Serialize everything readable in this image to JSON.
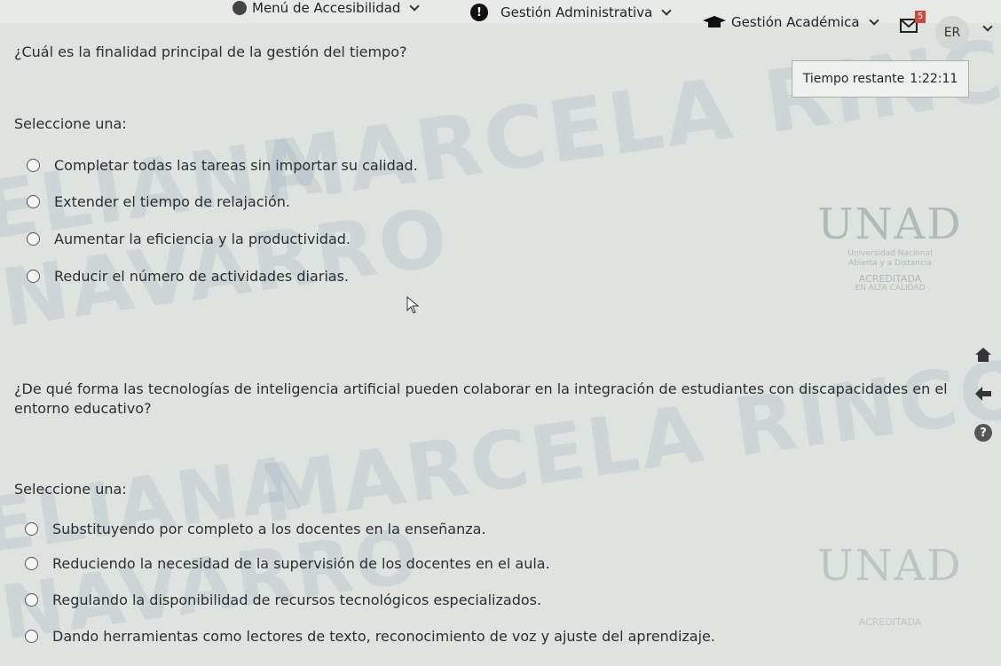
{
  "navbar": {
    "accessibility_menu": "Menú de Accesibilidad",
    "admin_menu": "Gestión Administrativa",
    "academic_menu": "Gestión Académica",
    "messages_count": "5",
    "user_initials": "ER"
  },
  "timer": {
    "label": "Tiempo restante",
    "value": "1:22:11"
  },
  "question1": {
    "text": "¿Cuál es la finalidad principal de la gestión del tiempo?",
    "select_label": "Seleccione una:",
    "options": [
      "Completar todas las tareas sin importar su calidad.",
      "Extender el tiempo de relajación.",
      "Aumentar la eficiencia y la productividad.",
      "Reducir el número de actividades diarias."
    ]
  },
  "question2": {
    "text": "¿De qué forma las tecnologías de inteligencia artificial pueden colaborar en la integración de estudiantes con discapacidades en el entorno educativo?",
    "select_label": "Seleccione una:",
    "options": [
      "Substituyendo por completo a los docentes en la enseñanza.",
      "Reduciendo la necesidad de la supervisión de los docentes en el aula.",
      "Regulando la disponibilidad de recursos tecnológicos especializados.",
      "Dando herramientas como lectores de texto, reconocimiento de voz y ajuste del aprendizaje."
    ]
  },
  "watermark": {
    "line1": "MARCELA RINCON",
    "line2": "ELIANA",
    "line3": "NAVARRO"
  },
  "logo": {
    "name": "UNAD",
    "line1": "Universidad Nacional",
    "line2": "Abierta y a Distancia",
    "line3": "ACREDITADA",
    "line4": "EN ALTA CALIDAD"
  },
  "icons": {
    "home": "home-icon",
    "back": "arrow-left-icon",
    "help": "help-icon"
  }
}
